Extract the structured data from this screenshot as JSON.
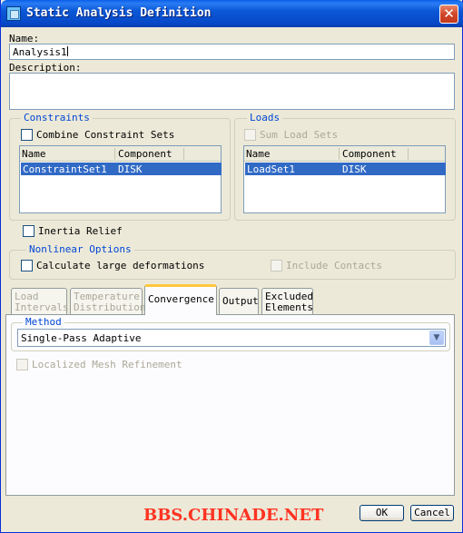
{
  "window": {
    "title": "Static Analysis Definition",
    "close_glyph": "✕"
  },
  "name": {
    "label": "Name:",
    "value": "Analysis1"
  },
  "description": {
    "label": "Description:",
    "value": ""
  },
  "constraints": {
    "title": "Constraints",
    "combine_label": "Combine Constraint Sets",
    "columns": [
      "Name",
      "Component"
    ],
    "rows": [
      {
        "name": "ConstraintSet1",
        "component": "DISK"
      }
    ]
  },
  "loads": {
    "title": "Loads",
    "sum_label": "Sum Load Sets",
    "columns": [
      "Name",
      "Component"
    ],
    "rows": [
      {
        "name": "LoadSet1",
        "component": "DISK"
      }
    ]
  },
  "inertia_relief_label": "Inertia Relief",
  "nonlinear": {
    "title": "Nonlinear Options",
    "large_def_label": "Calculate large deformations",
    "contacts_label": "Include Contacts"
  },
  "tabs": [
    {
      "line1": "Load",
      "line2": "Intervals"
    },
    {
      "line1": "Temperature",
      "line2": "Distribution"
    },
    {
      "line1": "Convergence",
      "line2": ""
    },
    {
      "line1": "Output",
      "line2": ""
    },
    {
      "line1": "Excluded",
      "line2": "Elements"
    }
  ],
  "convergence": {
    "method_title": "Method",
    "method_value": "Single-Pass Adaptive",
    "refinement_label": "Localized Mesh Refinement"
  },
  "buttons": {
    "ok": "OK",
    "cancel": "Cancel"
  },
  "watermark": "BBS.CHINADE.NET",
  "colors": {
    "selection": "#316ac5",
    "group_title": "#0046d5",
    "watermark": "#ff3322"
  }
}
